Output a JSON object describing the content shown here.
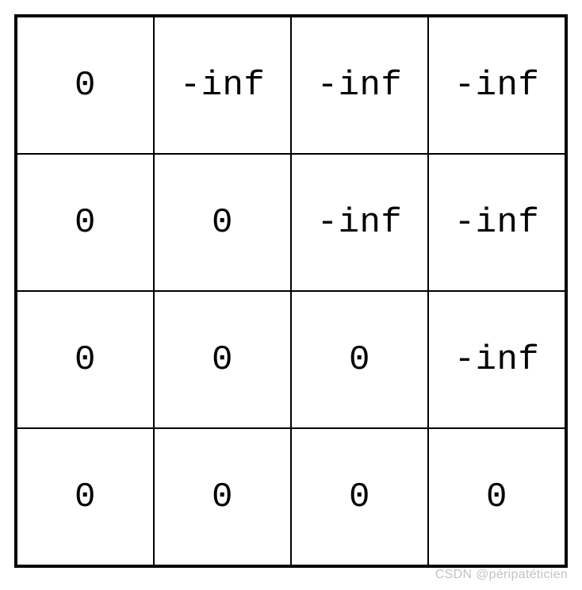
{
  "chart_data": {
    "type": "table",
    "title": "",
    "rows": 4,
    "cols": 4,
    "cells": [
      [
        "0",
        "-inf",
        "-inf",
        "-inf"
      ],
      [
        "0",
        "0",
        "-inf",
        "-inf"
      ],
      [
        "0",
        "0",
        "0",
        "-inf"
      ],
      [
        "0",
        "0",
        "0",
        "0"
      ]
    ]
  },
  "watermark": "CSDN @péripatéticien"
}
